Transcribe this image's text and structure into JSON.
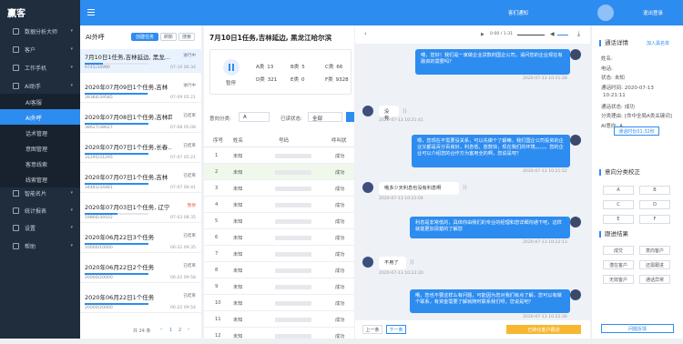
{
  "app": {
    "logo": "赢客"
  },
  "topbar": {
    "notice": "客们通知",
    "user_menu": "退出登录"
  },
  "sidebar": {
    "items": [
      {
        "label": "数据分析大师"
      },
      {
        "label": "客户"
      },
      {
        "label": "工作手机"
      },
      {
        "label": "AI助手"
      },
      {
        "label": "AI客服"
      },
      {
        "label": "AI外呼"
      },
      {
        "label": "话术管理"
      },
      {
        "label": "意图管理"
      },
      {
        "label": "客意线索"
      },
      {
        "label": "线索管理"
      },
      {
        "label": "智能名片"
      },
      {
        "label": "统计报表"
      },
      {
        "label": "设置"
      },
      {
        "label": "帮助"
      }
    ]
  },
  "tasklist": {
    "title": "AI外呼",
    "tabs": [
      "创建任务",
      "刷新",
      "搜索"
    ],
    "tasks": [
      {
        "name": "7月10日1任务,吉林延边, 黑龙...",
        "status": "进行中",
        "counts": "9745/34990",
        "time": "07-10 06:34",
        "progress": 0.28
      },
      {
        "name": "2020年07月09日1个任务,吉林",
        "status": "进行中",
        "counts": "39384/39585",
        "time": "07-09 05:21",
        "progress": 0.99
      },
      {
        "name": "2020年07月08日1个任务,吉林四平辽...",
        "status": "已结束",
        "counts": "38627/38627",
        "time": "07-08 05:08",
        "progress": 1
      },
      {
        "name": "2020年07月07日1个任务,长春...",
        "status": "已结束",
        "counts": "31295/31295",
        "time": "07-07 05:21",
        "progress": 1
      },
      {
        "name": "2020年07月07日1个任务,吉林",
        "status": "已结束",
        "counts": "34481/34481",
        "time": "07-07 06:41",
        "progress": 1
      },
      {
        "name": "2020年07月03日1个任务, 辽宁",
        "status": "暂停",
        "counts": "19866/39102",
        "time": "07-03 08:35",
        "progress": 0.51
      },
      {
        "name": "2020年06月22日3个任务",
        "status": "已结束",
        "counts": "10000/10000",
        "time": "06-22 09:35",
        "progress": 1
      },
      {
        "name": "2020年06月22日2个任务",
        "status": "已结束",
        "counts": "20000/20000",
        "time": "06-22 09:58",
        "progress": 1
      },
      {
        "name": "2020年06月22日1个任务",
        "status": "已结束",
        "counts": "20000/20000",
        "time": "06-22 09:54",
        "progress": 1
      }
    ],
    "pager": {
      "total": "共 24 条",
      "pages": [
        "1",
        "2"
      ]
    }
  },
  "detail": {
    "title": "7月10日1任务,吉林延边, 黑龙江哈尔滨",
    "pause_label": "暂停",
    "stats": [
      {
        "k": "A类",
        "v": "13"
      },
      {
        "k": "B类",
        "v": "5"
      },
      {
        "k": "C类",
        "v": "66"
      },
      {
        "k": "D类",
        "v": "321"
      },
      {
        "k": "E类",
        "v": "0"
      },
      {
        "k": "F类",
        "v": "9328"
      }
    ],
    "filter1_label": "意向分类:",
    "filter1_value": "A",
    "filter2_label": "已读状态:",
    "filter2_value": "全部",
    "cols": [
      "序号",
      "姓名",
      "号码",
      "呼叫状"
    ],
    "rows": [
      {
        "idx": "1",
        "name": "未知",
        "state": "成功"
      },
      {
        "idx": "2",
        "name": "未知",
        "state": "成功"
      },
      {
        "idx": "3",
        "name": "未知",
        "state": "成功"
      },
      {
        "idx": "4",
        "name": "未知",
        "state": "成功"
      },
      {
        "idx": "5",
        "name": "未知",
        "state": "成功"
      },
      {
        "idx": "6",
        "name": "未知",
        "state": "成功"
      },
      {
        "idx": "7",
        "name": "未知",
        "state": "成功"
      },
      {
        "idx": "8",
        "name": "未知",
        "state": "成功"
      },
      {
        "idx": "9",
        "name": "未知",
        "state": "成功"
      },
      {
        "idx": "10",
        "name": "未知",
        "state": "成功"
      },
      {
        "idx": "11",
        "name": "未知",
        "state": "成功"
      },
      {
        "idx": "12",
        "name": "未知",
        "state": "成功"
      }
    ]
  },
  "chat": {
    "audio_time": "0:00 / 1:31",
    "messages": [
      {
        "who": "bot",
        "text": "喂，您好！我们是一家做企业贷款的国企公司，请问您的企业现在有融资的需要吗？",
        "time": "2020-07-13 10:21:28"
      },
      {
        "who": "cust",
        "text": "没有",
        "time": "2020-07-13 10:21:41"
      },
      {
        "who": "bot",
        "text": "嗯，您现在不需要没关系，可以先做个了解嘛，我们国企公司投资的企业又都是百分百良好，利息低、放款快，现在我们的环境。。。。。您的企业可以介绍您的合作方为客用全的啊，您说是吧？",
        "time": "2020-07-13 10:21:52"
      },
      {
        "who": "cust",
        "text": "哦多少天利息也没有利息啊",
        "time": "2020-07-13 10:22:04"
      },
      {
        "who": "bot",
        "text": "利息是非常低的，具体你由我们的专业的经理和您详细沟通下吧，这样就能更加清楚的了解您",
        "time": "2020-07-13 10:22:13"
      },
      {
        "who": "cust",
        "text": "不用了",
        "time": "2020-07-13 10:22:20"
      },
      {
        "who": "bot",
        "text": "哦，您也不要这样么有问题，可能因为您对我们有点了解，您可以有做个联系，有资金需要了解就随时联系我们呀，您说是吧？",
        "time": "2020-07-13 10:22:26"
      }
    ],
    "prev": "上一条",
    "next": "下一条",
    "convert": "已转化客户跟进"
  },
  "right": {
    "title": "通话详情",
    "add_label": "加入黑名单",
    "fields": [
      {
        "k": "姓名:",
        "v": ""
      },
      {
        "k": "电话:",
        "v": ""
      },
      {
        "k": "状态:",
        "v": "未知"
      },
      {
        "k": "通话时间:",
        "v": "2020-07-13"
      },
      {
        "k": "",
        "v": "10:21:11"
      },
      {
        "k": "通话状态:",
        "v": "成功"
      },
      {
        "k": "分类理由:",
        "v": "[命中全局A类关键词]"
      },
      {
        "k": "AI意向:",
        "v": "A"
      }
    ],
    "section2": "意向分类校正",
    "cats": [
      "A",
      "B",
      "C",
      "D",
      "E",
      "F"
    ],
    "section3": "跟进结果",
    "results": [
      "成交",
      "意向客户",
      "潜在客户",
      "还需跟进",
      "无效客户",
      "通话异常"
    ],
    "duration_label": "通话时长01:32秒",
    "feedback": "问题反馈"
  },
  "colors": {
    "accent": "#2d8cf0",
    "sidebar": "#1f2d3d"
  }
}
